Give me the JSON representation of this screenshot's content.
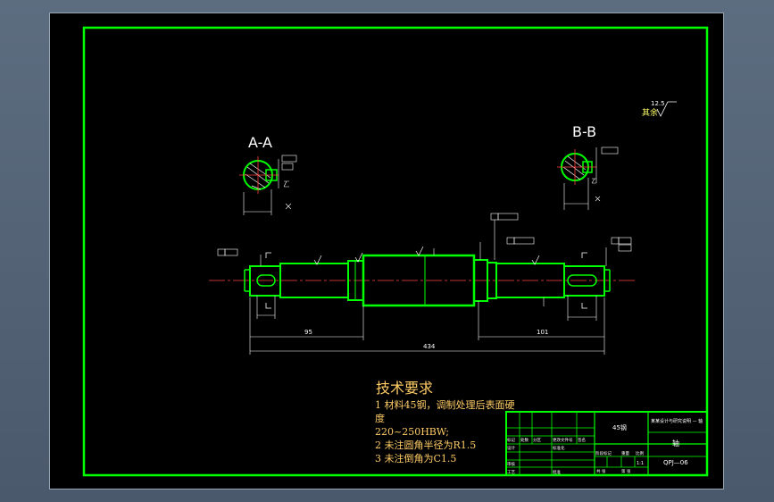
{
  "drawing": {
    "part_name": "轴",
    "material": "45钢",
    "drawing_no": "QPJ—06",
    "title_sub": "某某设计与研究说明 — 轴",
    "scale": "1:1"
  },
  "sections": {
    "a_label": "A-A",
    "b_label": "B-B"
  },
  "surface_note": {
    "roughness": "12.5",
    "text": "其余"
  },
  "tech": {
    "title": "技术要求",
    "line1": "1 材料45钢，调制处理后表面硬",
    "line2": "度",
    "line3": "220~250HBW;",
    "line4": "2 未注圆角半径为R1.5",
    "line5": "3 未注倒角为C1.5"
  },
  "dims": {
    "total": "434",
    "left_len": "95",
    "right_len": "101"
  },
  "title_block": {
    "cells": [
      "标记",
      "处数",
      "分区",
      "更改文件号",
      "签名",
      "年月日",
      "设计",
      "标准化",
      "审核",
      "工艺",
      "批准",
      "阶段标记",
      "重量",
      "比例",
      "共 张",
      "第 张"
    ]
  },
  "colors": {
    "frame": "#00ff00",
    "background": "#000000",
    "center_line": "#ff4040",
    "text": "#ffcc66"
  }
}
